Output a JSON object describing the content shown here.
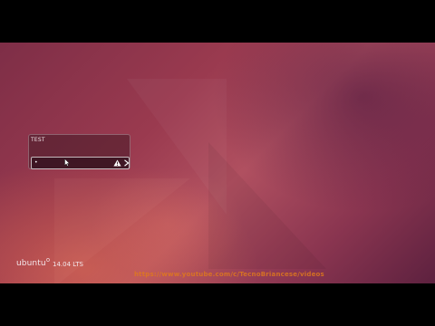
{
  "login": {
    "user_name": "TEST",
    "password_value": "•"
  },
  "branding": {
    "logo_text": "ubuntu",
    "version": "14.04 LTS"
  },
  "watermark": {
    "url_text": "https://www.youtube.com/c/TecnoBriancese/videos"
  },
  "colors": {
    "accent_orange": "#e07a1c",
    "background_main": "#9a3a4f"
  },
  "icons": {
    "warning": "warning-icon",
    "submit": "chevron-right-icon",
    "cursor": "mouse-cursor-icon"
  }
}
